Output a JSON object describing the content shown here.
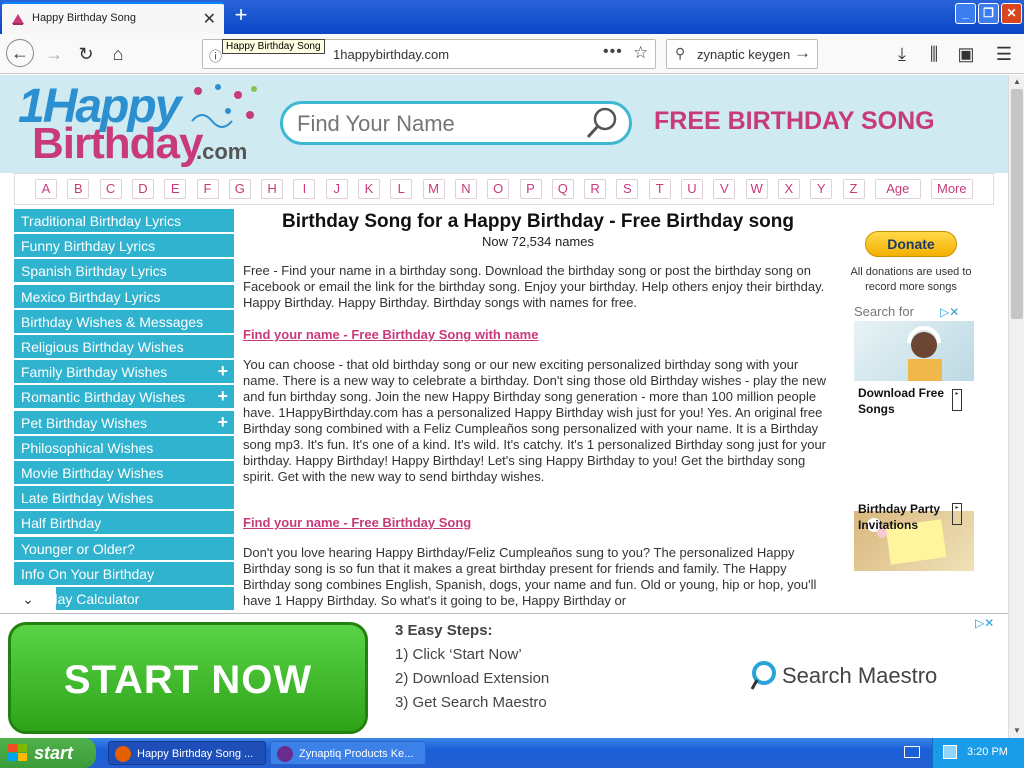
{
  "browser": {
    "tab_title": "Happy Birthday Song",
    "url": "1happybirthday.com",
    "tooltip": "Happy Birthday Song",
    "search_value": "zynaptic keygen"
  },
  "header": {
    "logo_line1": "1Happy",
    "logo_line2": "Birthday",
    "logo_line3": ".com",
    "find_placeholder": "Find Your Name",
    "tagline": "FREE BIRTHDAY SONG"
  },
  "alphabet": [
    "A",
    "B",
    "C",
    "D",
    "E",
    "F",
    "G",
    "H",
    "I",
    "J",
    "K",
    "L",
    "M",
    "N",
    "O",
    "P",
    "Q",
    "R",
    "S",
    "T",
    "U",
    "V",
    "W",
    "X",
    "Y",
    "Z",
    "Age",
    "More"
  ],
  "sidebar": {
    "items": [
      {
        "label": "Traditional Birthday Lyrics",
        "plus": false
      },
      {
        "label": "Funny Birthday Lyrics",
        "plus": false
      },
      {
        "label": "Spanish Birthday Lyrics",
        "plus": false
      },
      {
        "label": "Mexico Birthday Lyrics",
        "plus": false
      },
      {
        "label": "Birthday Wishes & Messages",
        "plus": false
      },
      {
        "label": "Religious Birthday Wishes",
        "plus": false
      },
      {
        "label": "Family Birthday Wishes",
        "plus": true
      },
      {
        "label": "Romantic Birthday Wishes",
        "plus": true
      },
      {
        "label": "Pet Birthday Wishes",
        "plus": true
      },
      {
        "label": "Philosophical Wishes",
        "plus": false
      },
      {
        "label": "Movie Birthday Wishes",
        "plus": false
      },
      {
        "label": "Late Birthday Wishes",
        "plus": false
      },
      {
        "label": "Half Birthday",
        "plus": false
      },
      {
        "label": "Younger or Older?",
        "plus": false
      },
      {
        "label": "Info On Your Birthday",
        "plus": false
      },
      {
        "label": "Birthday Calculator",
        "plus": false
      }
    ],
    "plus_symbol": "+",
    "collapse_symbol": "⌄"
  },
  "main": {
    "title": "Birthday Song for a Happy Birthday - Free Birthday song",
    "count": "Now 72,534 names",
    "para1": "Free - Find your name in a birthday song. Download the birthday song or post the birthday song on Facebook or email the link for the birthday song. Enjoy your birthday. Help others enjoy their birthday. Happy Birthday. Happy Birthday. Birthday songs with names for free.",
    "link1": "Find your name - Free Birthday Song with name",
    "para2": "You can choose - that old birthday song or our new exciting personalized birthday song with your name. There is a new way to celebrate a birthday. Don't sing those old Birthday wishes - play the new and fun birthday song. Join the new Happy Birthday song generation - more than 100 million people have. 1HappyBirthday.com has a personalized Happy Birthday wish just for you! Yes. An original free Birthday song combined with a Feliz Cumpleaños song personalized with your name. It is a Birthday song mp3. It's fun. It's one of a kind. It's wild. It's catchy. It's 1 personalized Birthday song just for your birthday. Happy Birthday! Happy Birthday! Let's sing Happy Birthday to you! Get the birthday song spirit. Get with the new way to send birthday wishes.",
    "link2": "Find your name - Free Birthday Song",
    "para3": "Don't you love hearing Happy Birthday/Feliz Cumpleaños sung to you? The personalized Happy Birthday song is so fun that it makes a great birthday present for friends and family. The Happy Birthday song combines English, Spanish, dogs, your name and fun. Old or young, hip or hop, you'll have 1 Happy Birthday. So what's it going to be, Happy Birthday or"
  },
  "right": {
    "donate": "Donate",
    "donate_note": "All donations are used to record more songs",
    "search_for": "Search for",
    "ads": [
      {
        "label": "Download Free Songs"
      },
      {
        "label": "Birthday Party Invitations"
      },
      {
        "label": ""
      }
    ]
  },
  "ad": {
    "button": "START NOW",
    "steps_title": "3 Easy Steps:",
    "steps": [
      "1) Click ‘Start Now’",
      "2) Download Extension",
      "3) Get Search Maestro"
    ],
    "brand": "Search Maestro"
  },
  "taskbar": {
    "start": "start",
    "items": [
      "Happy Birthday Song ...",
      "Zynaptiq Products Ke..."
    ],
    "time": "3:20 PM"
  },
  "colors": {
    "accent_pink": "#c83a7a",
    "nav_blue": "#2fb3cf",
    "header_bg": "#cfeaf0",
    "start_green": "#3c9c3a"
  }
}
